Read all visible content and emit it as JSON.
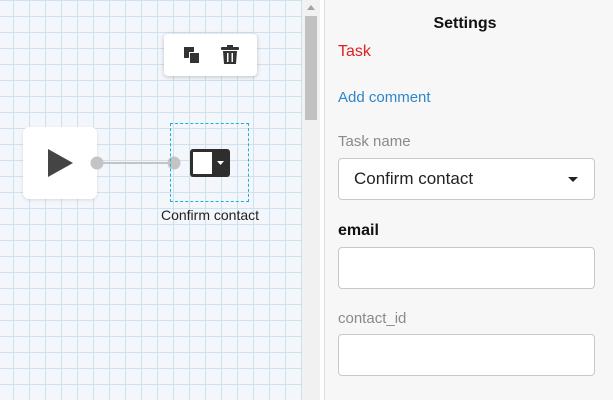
{
  "canvas": {
    "toolbar": {
      "copy_icon": "copy-icon",
      "delete_icon": "trash-icon"
    },
    "start_node": {
      "icon": "play-icon"
    },
    "task_node": {
      "icon": "dropdown-select-icon",
      "label": "Confirm contact"
    },
    "colors": {
      "grid": "#cfe0ee",
      "background": "#f3f7fb",
      "selection": "#18b4d6",
      "connector": "#c4c4c4"
    }
  },
  "settings": {
    "title": "Settings",
    "task_type": "Task",
    "add_comment": "Add comment",
    "task_name_label": "Task name",
    "task_name_value": "Confirm contact",
    "email_label": "email",
    "email_value": "",
    "contact_id_label": "contact_id",
    "contact_id_value": "",
    "colors": {
      "task_type": "#e02020",
      "link": "#2f86c9"
    }
  }
}
